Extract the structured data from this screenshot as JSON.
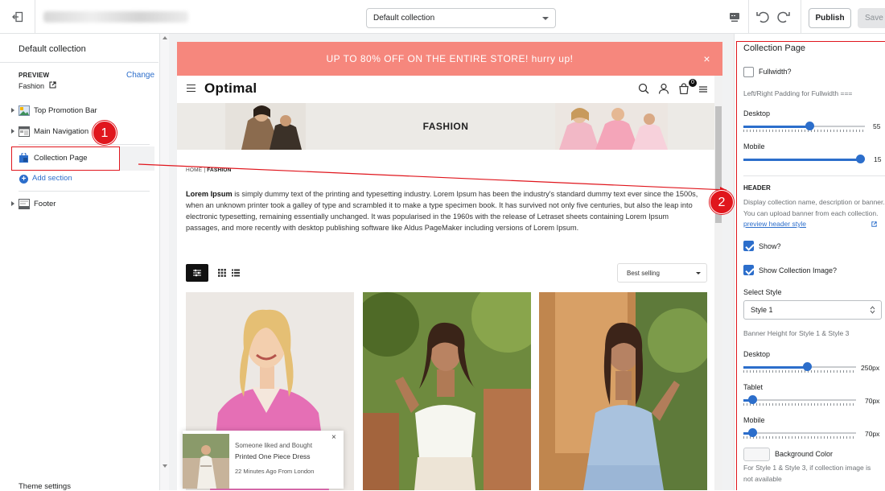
{
  "topbar": {
    "template_select": "Default collection",
    "publish_label": "Publish",
    "save_label": "Save"
  },
  "left_panel": {
    "title": "Default collection",
    "preview_label": "PREVIEW",
    "preview_value": "Fashion",
    "change_label": "Change",
    "sections": [
      {
        "label": "Top Promotion Bar"
      },
      {
        "label": "Main Navigation"
      },
      {
        "label": "Collection Page"
      },
      {
        "label": "Footer"
      }
    ],
    "add_section_label": "Add section",
    "theme_settings_label": "Theme settings"
  },
  "annotations": {
    "badge1": "1",
    "badge2": "2",
    "color": "#e0161d"
  },
  "preview": {
    "promo_text": "UP TO 80% OFF ON THE ENTIRE STORE! hurry up!",
    "promo_close": "×",
    "logo": "Optimal",
    "cart_count": "0",
    "banner_title": "FASHION",
    "breadcrumb_home": "HOME",
    "breadcrumb_sep": "|",
    "breadcrumb_current": "FASHION",
    "description_bold": "Lorem Ipsum",
    "description_rest": " is simply dummy text of the printing and typesetting industry. Lorem Ipsum has been the industry's standard dummy text ever since the 1500s, when an unknown printer took a galley of type and scrambled it to make a type specimen book. It has survived not only five centuries, but also the leap into electronic typesetting, remaining essentially unchanged. It was popularised in the 1960s with the release of Letraset sheets containing Lorem Ipsum passages, and more recently with desktop publishing software like Aldus PageMaker including versions of Lorem Ipsum.",
    "sort_value": "Best selling",
    "notification": {
      "line1": "Someone liked and Bought",
      "line2": "Printed One Piece Dress",
      "line3": "22 Minutes Ago From London",
      "close": "×"
    }
  },
  "right_panel": {
    "title": "Collection Page",
    "fullwidth_label": "Fullwidth?",
    "fullwidth_checked": false,
    "padding_label": "Left/Right Padding for Fullwidth ===",
    "desktop_label": "Desktop",
    "desktop_value": "55",
    "desktop_fraction": 0.55,
    "mobile_label": "Mobile",
    "mobile_value": "15",
    "mobile_fraction": 1.0,
    "header_heading": "HEADER",
    "header_desc": "Display collection name, description or banner. You can upload banner from each collection.",
    "header_link": "preview header style",
    "show_label": "Show?",
    "show_checked": true,
    "show_image_label": "Show Collection Image?",
    "show_image_checked": true,
    "select_style_label": "Select Style",
    "style_value": "Style 1",
    "banner_height_label": "Banner Height for Style 1 & Style 3",
    "bh_desktop_label": "Desktop",
    "bh_desktop_value": "250px",
    "bh_tablet_label": "Tablet",
    "bh_tablet_value": "70px",
    "bh_mobile_label": "Mobile",
    "bh_mobile_value": "70px",
    "bg_color_label": "Background Color",
    "bg_color_desc": "For Style 1 & Style 3, if collection image is not available"
  }
}
